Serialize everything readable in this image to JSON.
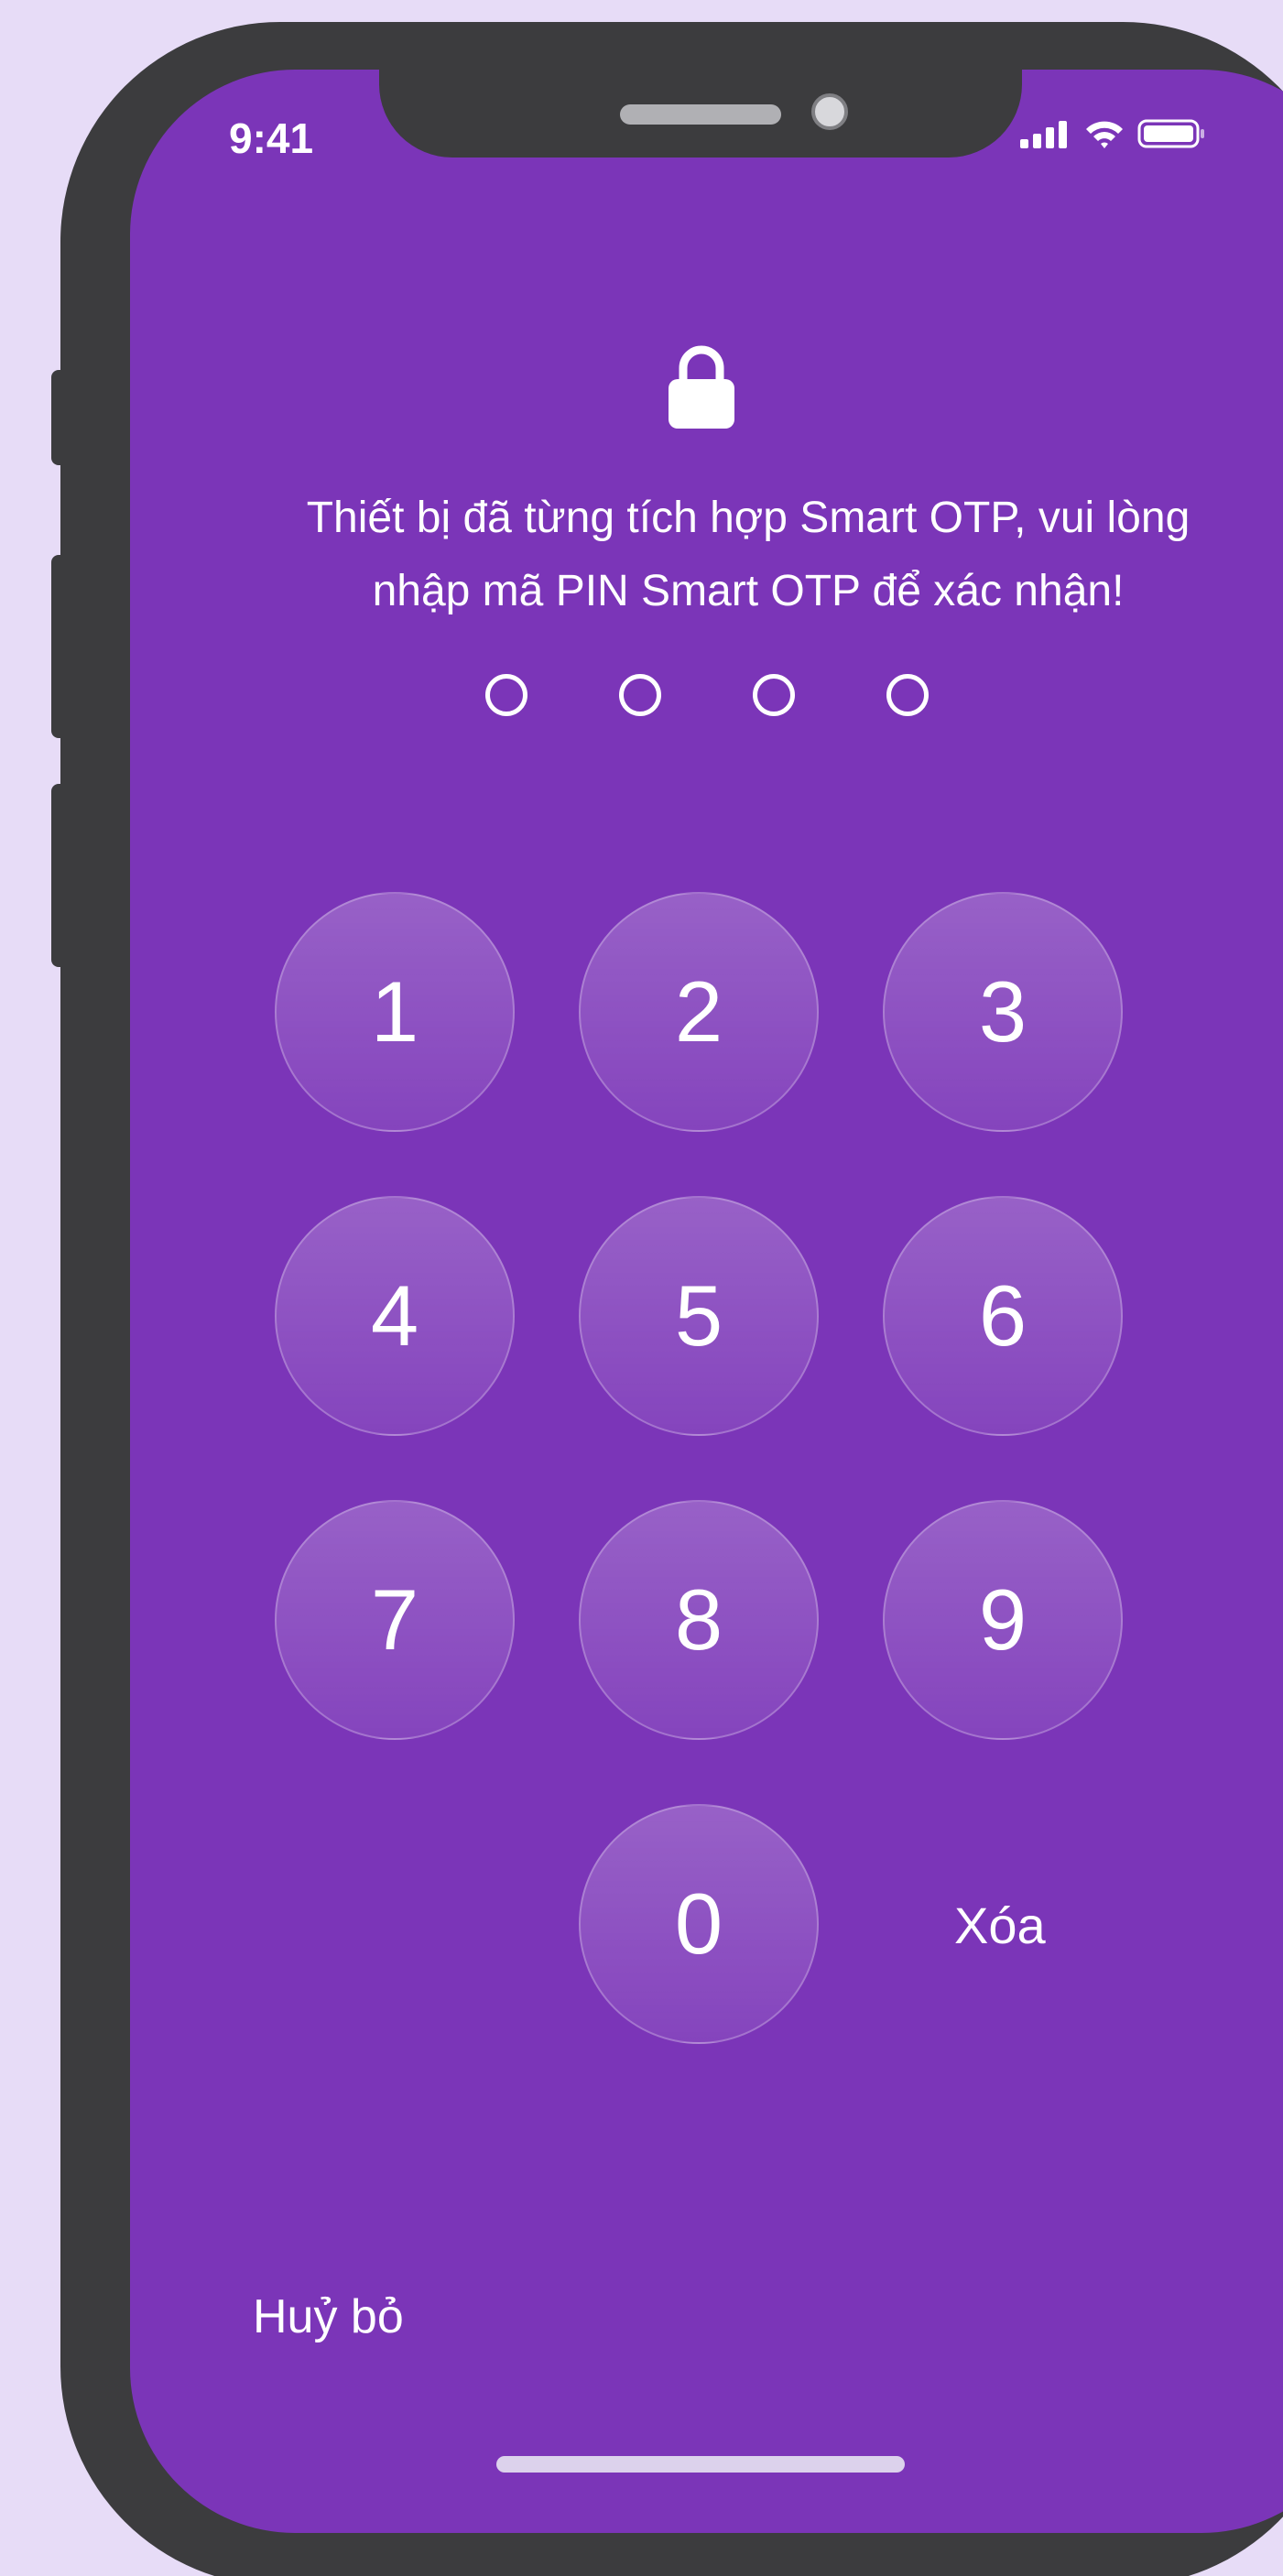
{
  "status_bar": {
    "time": "9:41",
    "icons": [
      "cellular-signal-icon",
      "wifi-icon",
      "battery-icon"
    ]
  },
  "lock_icon": "lock-icon",
  "prompt": {
    "line1": "Thiết bị đã từng tích hợp Smart OTP, vui lòng",
    "line2": "nhập mã PIN Smart OTP để xác nhận!"
  },
  "pin": {
    "length": 4,
    "entered": 0
  },
  "keypad": {
    "keys": [
      "1",
      "2",
      "3",
      "4",
      "5",
      "6",
      "7",
      "8",
      "9",
      "0"
    ],
    "delete_label": "Xóa"
  },
  "cancel_label": "Huỷ bỏ",
  "colors": {
    "screen_background": "#7b35b8",
    "page_background": "#e7dcf7",
    "frame": "#3c3c3e",
    "text": "#ffffff"
  }
}
